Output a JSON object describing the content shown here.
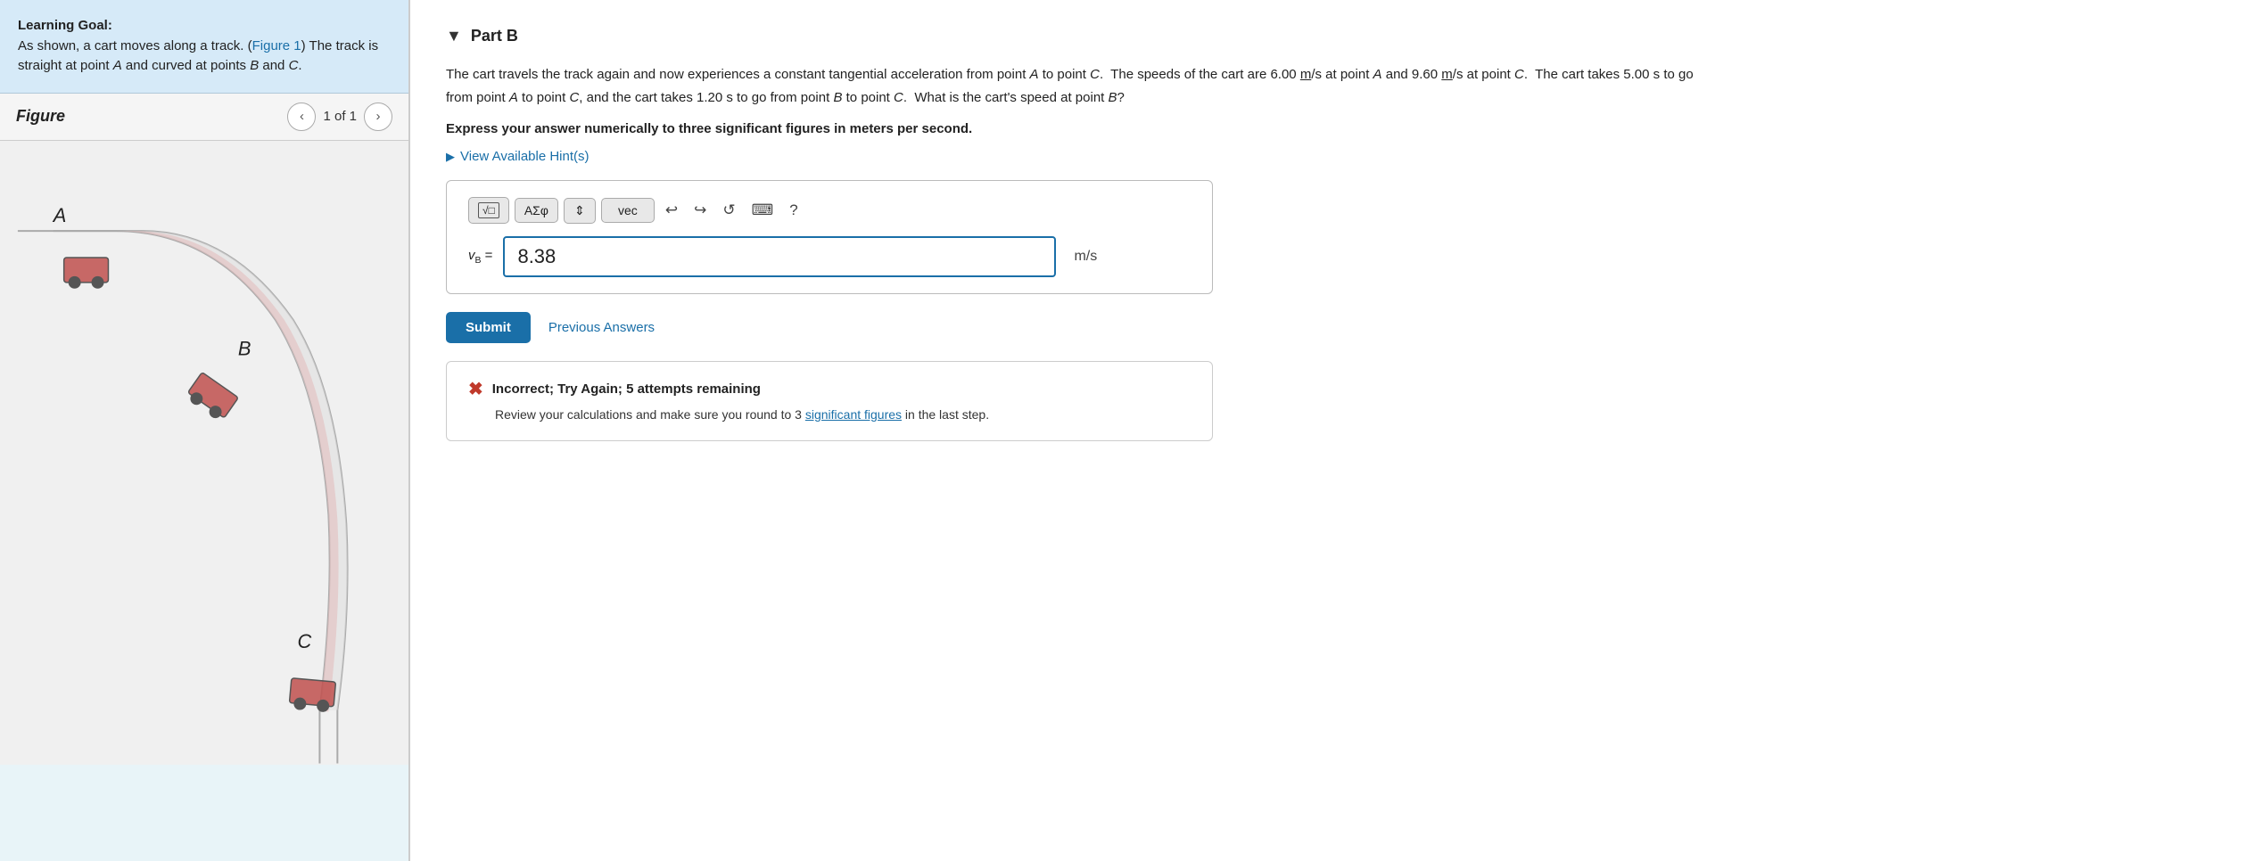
{
  "left": {
    "learning_goal_label": "Learning Goal:",
    "learning_goal_text": "As shown, a cart moves along a track. (",
    "figure_link": "Figure 1",
    "learning_goal_text2": ") The track is straight at point ",
    "learning_goal_italic1": "A",
    "learning_goal_text3": " and curved at points ",
    "learning_goal_italic2": "B",
    "learning_goal_text4": " and ",
    "learning_goal_italic3": "C",
    "learning_goal_text5": ".",
    "figure_title": "Figure",
    "figure_page": "1 of 1",
    "figure_prev_label": "‹",
    "figure_next_label": "›"
  },
  "right": {
    "part_title": "Part B",
    "question": "The cart travels the track again and now experiences a constant tangential acceleration from point A to point C.  The speeds of the cart are 6.00 m/s at point A and 9.60 m/s at point C.  The cart takes 5.00 s to go from point A to point C, and the cart takes 1.20 s to go from point B to point C.  What is the cart's speed at point B?",
    "instruction": "Express your answer numerically to three significant figures in meters per second.",
    "hint_link": "View Available Hint(s)",
    "toolbar": {
      "btn1": "√□",
      "btn2": "ΑΣφ",
      "btn3": "↕",
      "btn4": "vec",
      "undo": "↩",
      "redo": "↪",
      "refresh": "↺",
      "keyboard": "⌨",
      "help": "?"
    },
    "input_label": "v_B =",
    "input_value": "8.38",
    "unit": "m/s",
    "submit_label": "Submit",
    "prev_answers_label": "Previous Answers",
    "feedback": {
      "title": "Incorrect; Try Again; 5 attempts remaining",
      "body_start": "Review your calculations and make sure you round to 3 ",
      "body_link": "significant figures",
      "body_end": " in the last step."
    }
  }
}
